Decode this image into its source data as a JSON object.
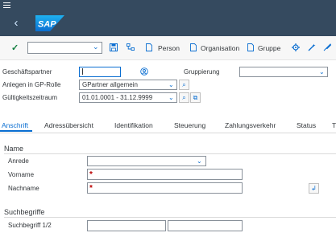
{
  "toolbar": {
    "person_label": "Person",
    "organisation_label": "Organisation",
    "gruppe_label": "Gruppe"
  },
  "header": {
    "geschaeftspartner_label": "Geschäftspartner",
    "gruppierung_label": "Gruppierung",
    "anlegen_label": "Anlegen in GP-Rolle",
    "anlegen_value": "GPartner allgemein",
    "gueltigkeit_label": "Gültigkeitszeitraum",
    "gueltigkeit_value": "01.01.0001 - 31.12.9999"
  },
  "tabs": [
    {
      "label": "Anschrift",
      "active": true
    },
    {
      "label": "Adressübersicht"
    },
    {
      "label": "Identifikation"
    },
    {
      "label": "Steuerung"
    },
    {
      "label": "Zahlungsverkehr"
    },
    {
      "label": "Status"
    },
    {
      "label": "T"
    }
  ],
  "name_section": {
    "title": "Name",
    "anrede_label": "Anrede",
    "vorname_label": "Vorname",
    "nachname_label": "Nachname",
    "required_marker": "*"
  },
  "suchbegriffe_section": {
    "title": "Suchbegriffe",
    "suchbegriff_label": "Suchbegriff 1/2"
  },
  "colors": {
    "shell": "#354a5f",
    "accent": "#0a6ed1",
    "required": "#bb0000",
    "success": "#107e3e"
  },
  "icons": [
    "menu-icon",
    "back-icon",
    "sap-logo",
    "check-icon",
    "save-icon",
    "hierarchy-icon",
    "document-icon",
    "settings-icon",
    "value-help-icon"
  ]
}
